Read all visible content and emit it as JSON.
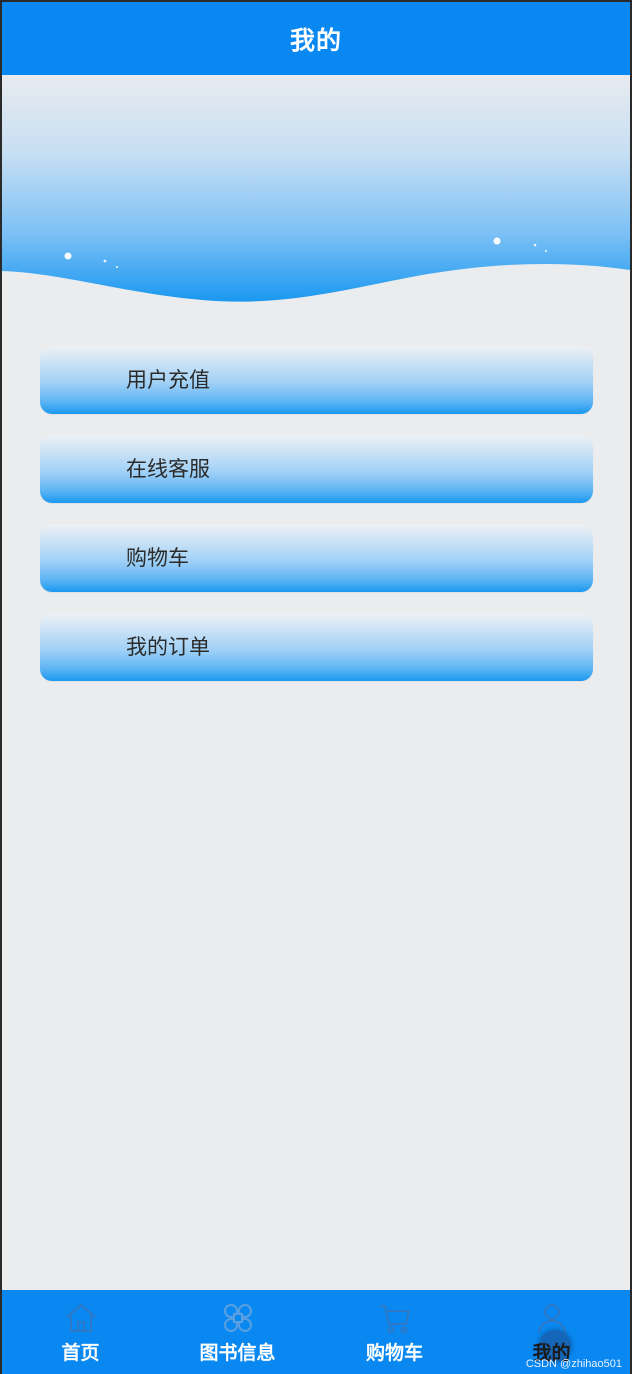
{
  "header": {
    "title": "我的"
  },
  "menu": {
    "items": [
      {
        "label": "用户充值"
      },
      {
        "label": "在线客服"
      },
      {
        "label": "购物车"
      },
      {
        "label": "我的订单"
      }
    ]
  },
  "tabbar": {
    "active_index": 3,
    "items": [
      {
        "label": "首页",
        "icon": "home-icon"
      },
      {
        "label": "图书信息",
        "icon": "command-icon"
      },
      {
        "label": "购物车",
        "icon": "cart-icon"
      },
      {
        "label": "我的",
        "icon": "user-icon"
      }
    ]
  },
  "watermark": "CSDN @zhihao501",
  "colors": {
    "primary": "#0a88f2",
    "background": "#ebecee",
    "text": "#2b2b2b"
  }
}
